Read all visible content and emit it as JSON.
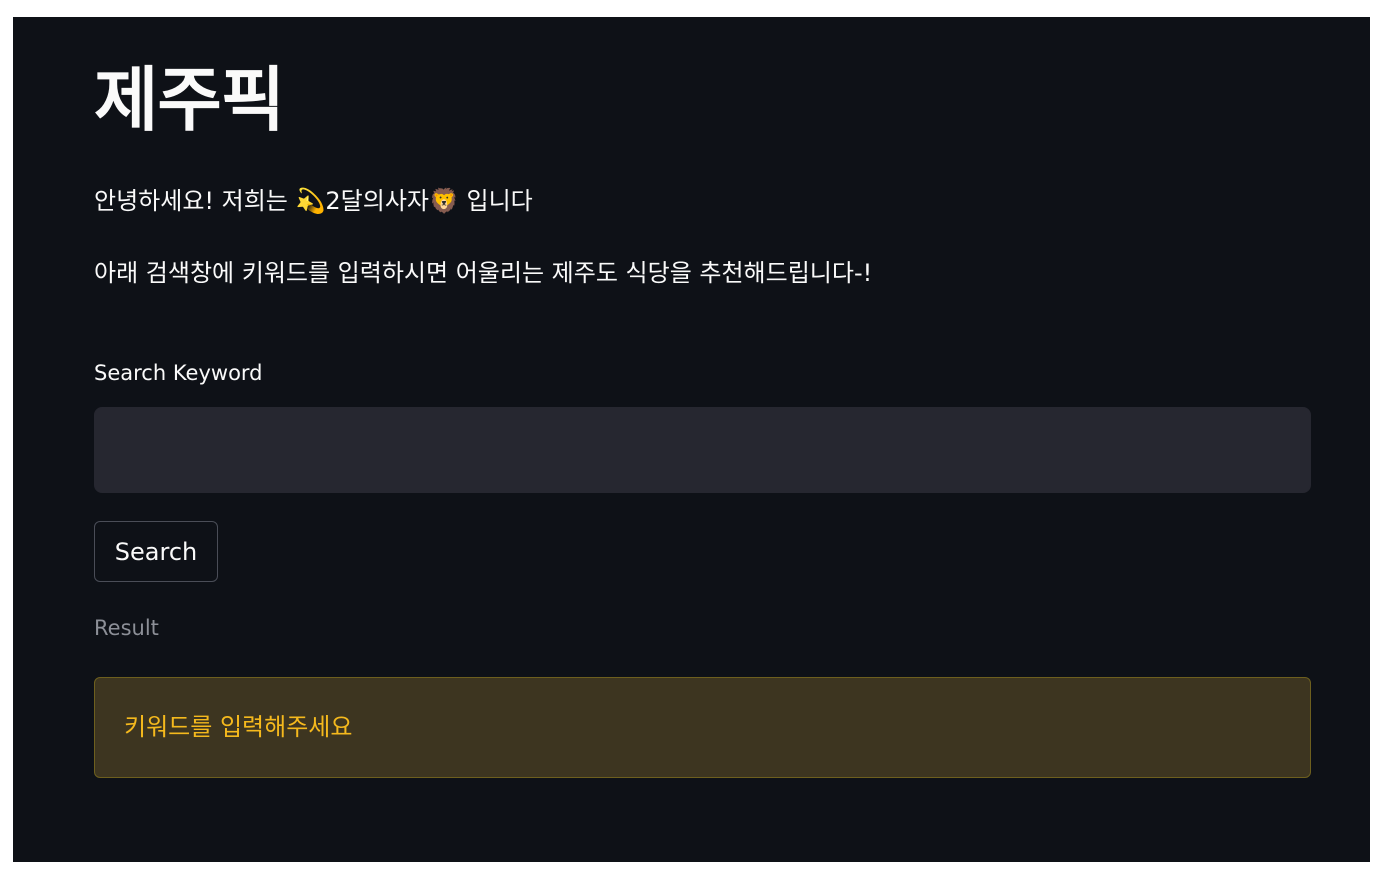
{
  "page": {
    "title": "제주픽",
    "intro": "안녕하세요! 저희는 💫2달의사자🦁 입니다",
    "description": "아래 검색창에 키워드를 입력하시면 어울리는 제주도 식당을 추천해드립니다-!"
  },
  "search": {
    "label": "Search Keyword",
    "value": "",
    "placeholder": "",
    "button_label": "Search"
  },
  "result": {
    "label": "Result",
    "message": "키워드를 입력해주세요"
  },
  "colors": {
    "background": "#0e1117",
    "input_background": "#262730",
    "warning_background": "#3d3520",
    "warning_text": "#f5b91d",
    "muted_text": "#8c8f97"
  }
}
